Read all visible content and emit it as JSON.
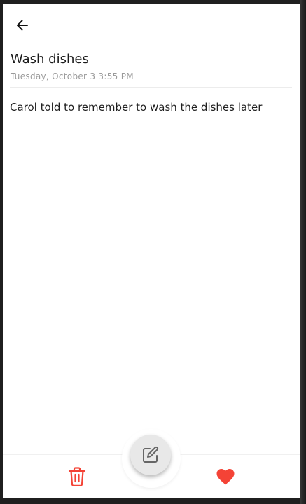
{
  "note": {
    "title": "Wash dishes",
    "date": "Tuesday, October 3 3:55 PM",
    "body": "Carol told to remember to wash the dishes later"
  },
  "icons": {
    "back": "arrow-left-icon",
    "edit": "edit-icon",
    "delete": "trash-icon",
    "favorite": "heart-icon"
  },
  "colors": {
    "accent": "#f44336",
    "fab_background": "#e8e8e8",
    "date_text": "#9a9a9a"
  },
  "state": {
    "favorite": true
  }
}
